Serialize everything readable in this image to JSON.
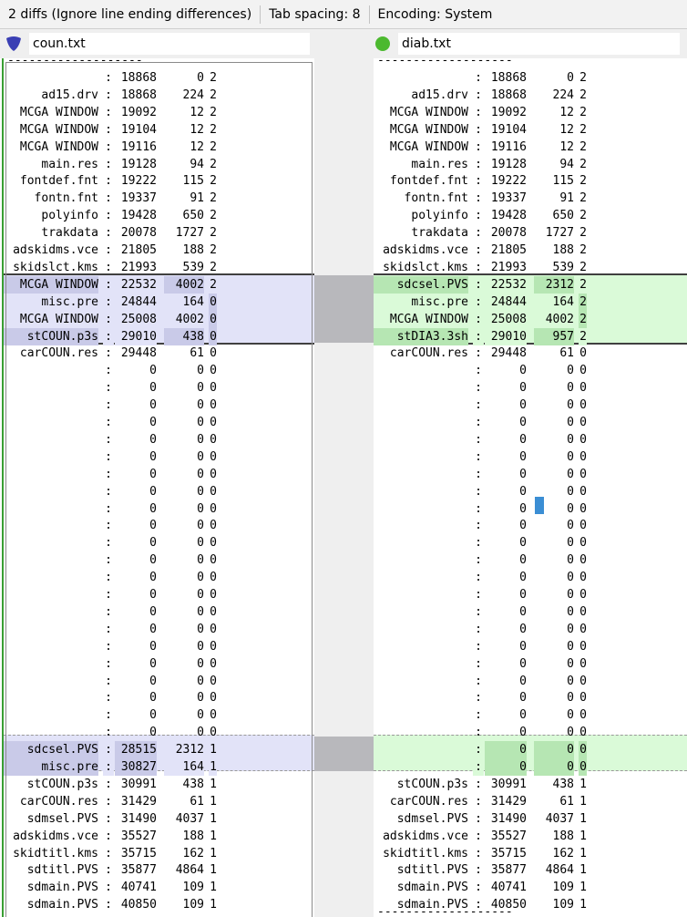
{
  "statusbar": {
    "diffs": "2 diffs (Ignore line ending differences)",
    "tab_spacing": "Tab spacing: 8",
    "encoding": "Encoding: System"
  },
  "left_file": {
    "name": "coun.txt",
    "icon": "blue-shield-icon",
    "color": "#3a3fb4"
  },
  "right_file": {
    "name": "diab.txt",
    "icon": "green-circle-icon",
    "color": "#4cb92f"
  },
  "separator": "-------------------",
  "colors": {
    "left_highlight": "#e2e3f8",
    "right_highlight": "#dafad8",
    "cursor": "#3b8ed4",
    "left_border": "#3a9f33"
  },
  "left_lines": [
    [
      "",
      ":",
      "18868",
      "0",
      "2"
    ],
    [
      "ad15.drv",
      ":",
      "18868",
      "224",
      "2"
    ],
    [
      "MCGA WINDOW",
      ":",
      "19092",
      "12",
      "2"
    ],
    [
      "MCGA WINDOW",
      ":",
      "19104",
      "12",
      "2"
    ],
    [
      "MCGA WINDOW",
      ":",
      "19116",
      "12",
      "2"
    ],
    [
      "main.res",
      ":",
      "19128",
      "94",
      "2"
    ],
    [
      "fontdef.fnt",
      ":",
      "19222",
      "115",
      "2"
    ],
    [
      "fontn.fnt",
      ":",
      "19337",
      "91",
      "2"
    ],
    [
      "polyinfo",
      ":",
      "19428",
      "650",
      "2"
    ],
    [
      "trakdata",
      ":",
      "20078",
      "1727",
      "2"
    ],
    [
      "adskidms.vce",
      ":",
      "21805",
      "188",
      "2"
    ],
    [
      "skidslct.kms",
      ":",
      "21993",
      "539",
      "2"
    ],
    [
      "MCGA WINDOW",
      ":",
      "22532",
      "4002",
      "2"
    ],
    [
      "misc.pre",
      ":",
      "24844",
      "164",
      "0"
    ],
    [
      "MCGA WINDOW",
      ":",
      "25008",
      "4002",
      "0"
    ],
    [
      "stCOUN.p3s",
      ":",
      "29010",
      "438",
      "0"
    ],
    [
      "carCOUN.res",
      ":",
      "29448",
      "61",
      "0"
    ],
    [
      "",
      ":",
      "0",
      "0",
      "0"
    ],
    [
      "",
      ":",
      "0",
      "0",
      "0"
    ],
    [
      "",
      ":",
      "0",
      "0",
      "0"
    ],
    [
      "",
      ":",
      "0",
      "0",
      "0"
    ],
    [
      "",
      ":",
      "0",
      "0",
      "0"
    ],
    [
      "",
      ":",
      "0",
      "0",
      "0"
    ],
    [
      "",
      ":",
      "0",
      "0",
      "0"
    ],
    [
      "",
      ":",
      "0",
      "0",
      "0"
    ],
    [
      "",
      ":",
      "0",
      "0",
      "0"
    ],
    [
      "",
      ":",
      "0",
      "0",
      "0"
    ],
    [
      "",
      ":",
      "0",
      "0",
      "0"
    ],
    [
      "",
      ":",
      "0",
      "0",
      "0"
    ],
    [
      "",
      ":",
      "0",
      "0",
      "0"
    ],
    [
      "",
      ":",
      "0",
      "0",
      "0"
    ],
    [
      "",
      ":",
      "0",
      "0",
      "0"
    ],
    [
      "",
      ":",
      "0",
      "0",
      "0"
    ],
    [
      "",
      ":",
      "0",
      "0",
      "0"
    ],
    [
      "",
      ":",
      "0",
      "0",
      "0"
    ],
    [
      "",
      ":",
      "0",
      "0",
      "0"
    ],
    [
      "",
      ":",
      "0",
      "0",
      "0"
    ],
    [
      "",
      ":",
      "0",
      "0",
      "0"
    ],
    [
      "",
      ":",
      "0",
      "0",
      "0"
    ],
    [
      "sdcsel.PVS",
      ":",
      "28515",
      "2312",
      "1"
    ],
    [
      "misc.pre",
      ":",
      "30827",
      "164",
      "1"
    ],
    [
      "stCOUN.p3s",
      ":",
      "30991",
      "438",
      "1"
    ],
    [
      "carCOUN.res",
      ":",
      "31429",
      "61",
      "1"
    ],
    [
      "sdmsel.PVS",
      ":",
      "31490",
      "4037",
      "1"
    ],
    [
      "adskidms.vce",
      ":",
      "35527",
      "188",
      "1"
    ],
    [
      "skidtitl.kms",
      ":",
      "35715",
      "162",
      "1"
    ],
    [
      "sdtitl.PVS",
      ":",
      "35877",
      "4864",
      "1"
    ],
    [
      "sdmain.PVS",
      ":",
      "40741",
      "109",
      "1"
    ],
    [
      "sdmain.PVS",
      ":",
      "40850",
      "109",
      "1"
    ]
  ],
  "right_lines": [
    [
      "",
      ":",
      "18868",
      "0",
      "2"
    ],
    [
      "ad15.drv",
      ":",
      "18868",
      "224",
      "2"
    ],
    [
      "MCGA WINDOW",
      ":",
      "19092",
      "12",
      "2"
    ],
    [
      "MCGA WINDOW",
      ":",
      "19104",
      "12",
      "2"
    ],
    [
      "MCGA WINDOW",
      ":",
      "19116",
      "12",
      "2"
    ],
    [
      "main.res",
      ":",
      "19128",
      "94",
      "2"
    ],
    [
      "fontdef.fnt",
      ":",
      "19222",
      "115",
      "2"
    ],
    [
      "fontn.fnt",
      ":",
      "19337",
      "91",
      "2"
    ],
    [
      "polyinfo",
      ":",
      "19428",
      "650",
      "2"
    ],
    [
      "trakdata",
      ":",
      "20078",
      "1727",
      "2"
    ],
    [
      "adskidms.vce",
      ":",
      "21805",
      "188",
      "2"
    ],
    [
      "skidslct.kms",
      ":",
      "21993",
      "539",
      "2"
    ],
    [
      "sdcsel.PVS",
      ":",
      "22532",
      "2312",
      "2"
    ],
    [
      "misc.pre",
      ":",
      "24844",
      "164",
      "2"
    ],
    [
      "MCGA WINDOW",
      ":",
      "25008",
      "4002",
      "2"
    ],
    [
      "stDIA3.3sh",
      ":",
      "29010",
      "957",
      "2"
    ],
    [
      "carCOUN.res",
      ":",
      "29448",
      "61",
      "0"
    ],
    [
      "",
      ":",
      "0",
      "0",
      "0"
    ],
    [
      "",
      ":",
      "0",
      "0",
      "0"
    ],
    [
      "",
      ":",
      "0",
      "0",
      "0"
    ],
    [
      "",
      ":",
      "0",
      "0",
      "0"
    ],
    [
      "",
      ":",
      "0",
      "0",
      "0"
    ],
    [
      "",
      ":",
      "0",
      "0",
      "0"
    ],
    [
      "",
      ":",
      "0",
      "0",
      "0"
    ],
    [
      "",
      ":",
      "0",
      "0",
      "0"
    ],
    [
      "",
      ":",
      "0",
      "0",
      "0"
    ],
    [
      "",
      ":",
      "0",
      "0",
      "0"
    ],
    [
      "",
      ":",
      "0",
      "0",
      "0"
    ],
    [
      "",
      ":",
      "0",
      "0",
      "0"
    ],
    [
      "",
      ":",
      "0",
      "0",
      "0"
    ],
    [
      "",
      ":",
      "0",
      "0",
      "0"
    ],
    [
      "",
      ":",
      "0",
      "0",
      "0"
    ],
    [
      "",
      ":",
      "0",
      "0",
      "0"
    ],
    [
      "",
      ":",
      "0",
      "0",
      "0"
    ],
    [
      "",
      ":",
      "0",
      "0",
      "0"
    ],
    [
      "",
      ":",
      "0",
      "0",
      "0"
    ],
    [
      "",
      ":",
      "0",
      "0",
      "0"
    ],
    [
      "",
      ":",
      "0",
      "0",
      "0"
    ],
    [
      "",
      ":",
      "0",
      "0",
      "0"
    ],
    [
      "",
      ":",
      "0",
      "0",
      "0"
    ],
    [
      "",
      ":",
      "0",
      "0",
      "0"
    ],
    [
      "stCOUN.p3s",
      ":",
      "30991",
      "438",
      "1"
    ],
    [
      "carCOUN.res",
      ":",
      "31429",
      "61",
      "1"
    ],
    [
      "sdmsel.PVS",
      ":",
      "31490",
      "4037",
      "1"
    ],
    [
      "adskidms.vce",
      ":",
      "35527",
      "188",
      "1"
    ],
    [
      "skidtitl.kms",
      ":",
      "35715",
      "162",
      "1"
    ],
    [
      "sdtitl.PVS",
      ":",
      "35877",
      "4864",
      "1"
    ],
    [
      "sdmain.PVS",
      ":",
      "40741",
      "109",
      "1"
    ],
    [
      "sdmain.PVS",
      ":",
      "40850",
      "109",
      "1"
    ]
  ]
}
